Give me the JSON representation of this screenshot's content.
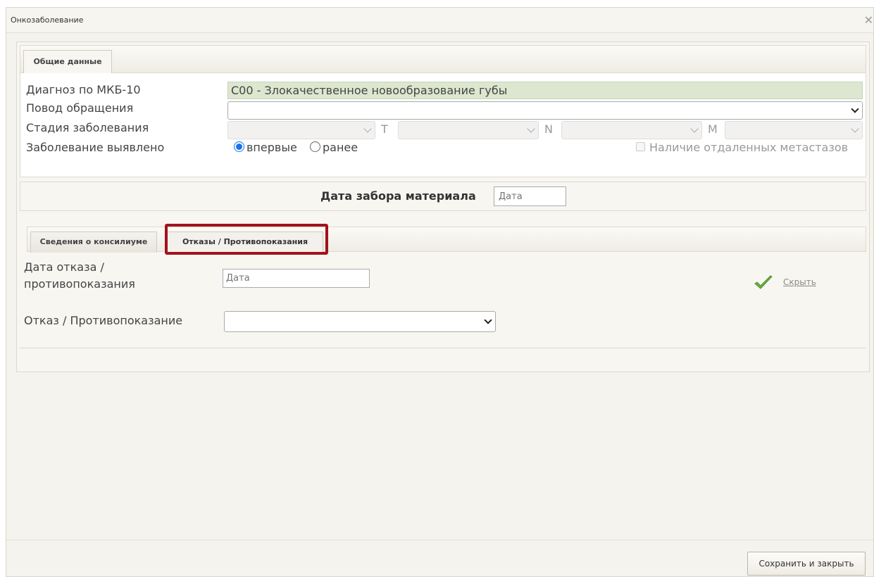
{
  "dialog": {
    "title": "Онкозаболевание",
    "close_icon": "close-icon"
  },
  "tabs": {
    "general": "Общие данные"
  },
  "form": {
    "diagnosis_label": "Диагноз по МКБ-10",
    "diagnosis_value": "C00 - Злокачественное новообразование губы",
    "reason_label": "Повод обращения",
    "reason_value": "",
    "stage_label": "Стадия заболевания",
    "stage_t": "T",
    "stage_n": "N",
    "stage_m": "M",
    "detected_label": "Заболевание выявлено",
    "detected_options": [
      "впервые",
      "ранее"
    ],
    "detected_selected": "впервые",
    "metastasis_label": "Наличие отдаленных метастазов"
  },
  "material": {
    "label": "Дата забора материала",
    "placeholder": "Дата"
  },
  "subtabs": {
    "council": "Сведения о консилиуме",
    "refusal": "Отказы / Противопоказания"
  },
  "refusal": {
    "date_label": "Дата отказа / противопоказания",
    "date_placeholder": "Дата",
    "type_label": "Отказ / Противопоказание",
    "type_value": "",
    "hide_link": "Скрыть",
    "confirm_icon": "checkmark-icon"
  },
  "footer": {
    "save_label": "Сохранить и закрыть"
  },
  "colors": {
    "highlight": "#a3121d",
    "diagnosis_bg": "#dde6cf",
    "radio_selected": "#1a73e8",
    "check_green": "#6cb33f"
  }
}
